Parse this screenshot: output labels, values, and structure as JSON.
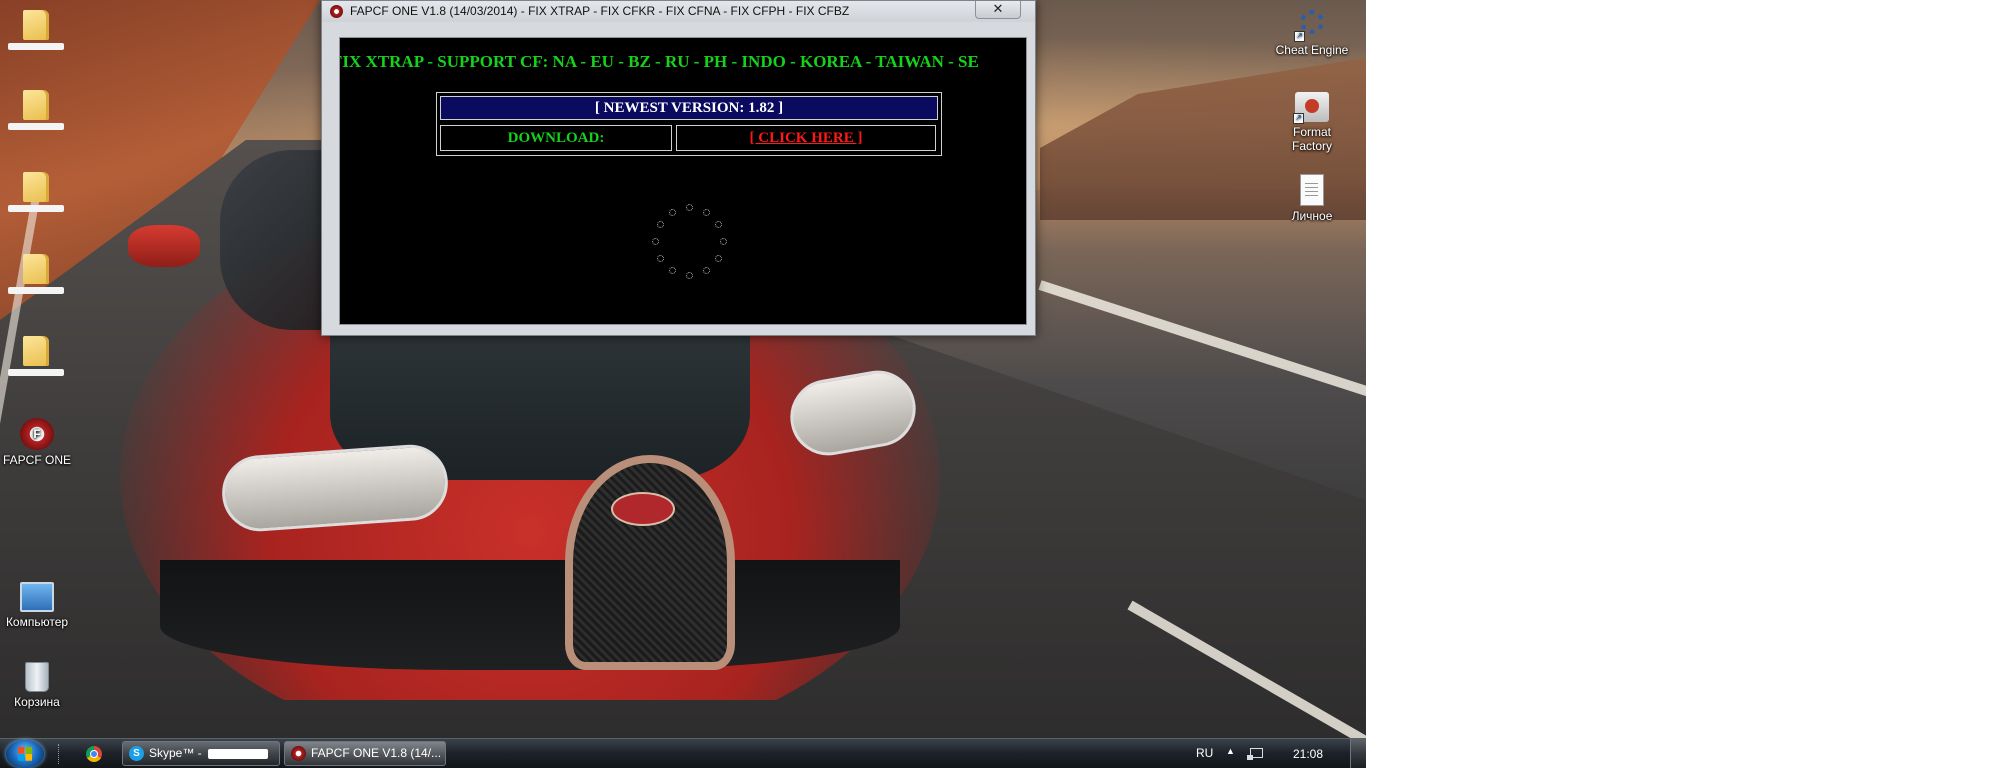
{
  "window": {
    "title": "FAPCF ONE V1.8 (14/03/2014) - FIX XTRAP - FIX CFKR - FIX CFNA - FIX CFPH - FIX CFBZ",
    "close_glyph": "✕",
    "marquee_text": "FIX XTRAP - SUPPORT CF: NA - EU - BZ - RU - PH - INDO - KOREA - TAIWAN - SE",
    "newest_version": "[ NEWEST VERSION: 1.82 ]",
    "download_label": "DOWNLOAD:",
    "download_link": "[ CLICK HERE ]",
    "colors": {
      "marquee": "#16d21a",
      "link": "#ff1a1a",
      "version_bg": "#0a0a5e",
      "client_bg": "#000000"
    }
  },
  "desktop": {
    "left_icons": [
      {
        "icon": "folder-icon",
        "label": ""
      },
      {
        "icon": "folder-icon",
        "label": ""
      },
      {
        "icon": "folder-icon",
        "label": ""
      },
      {
        "icon": "folder-icon",
        "label": ""
      },
      {
        "icon": "folder-icon",
        "label": ""
      },
      {
        "icon": "fapcf-one-icon",
        "label": "FAPCF ONE"
      },
      {
        "icon": "computer-icon",
        "label": "Компьютер"
      },
      {
        "icon": "recycle-bin-icon",
        "label": "Корзина"
      }
    ],
    "right_icons": [
      {
        "icon": "cheat-engine-icon",
        "label": "Cheat Engine"
      },
      {
        "icon": "format-factory-icon",
        "label": "Format Factory"
      },
      {
        "icon": "document-icon",
        "label": "Личное"
      }
    ]
  },
  "taskbar": {
    "skype_label": "Skype™ -",
    "fapcf_label": "FAPCF ONE V1.8 (14/...",
    "language": "RU",
    "tray_arrow": "▲",
    "clock": "21:08"
  }
}
